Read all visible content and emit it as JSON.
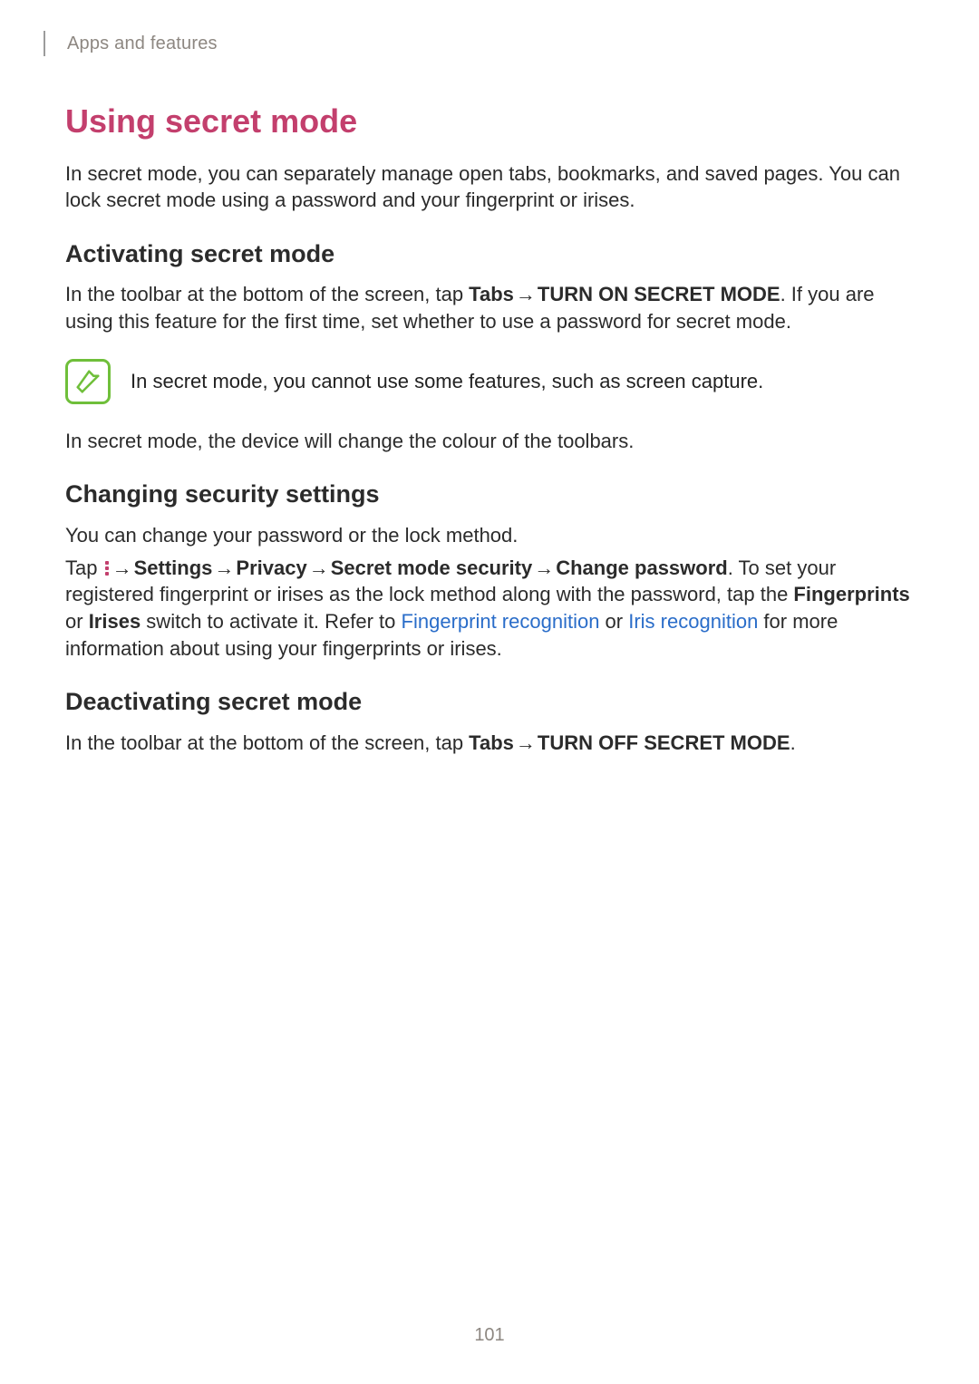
{
  "header": {
    "breadcrumb": "Apps and features"
  },
  "title": "Using secret mode",
  "intro": "In secret mode, you can separately manage open tabs, bookmarks, and saved pages. You can lock secret mode using a password and your fingerprint or irises.",
  "activating": {
    "heading": "Activating secret mode",
    "p1_a": "In the toolbar at the bottom of the screen, tap ",
    "tabs_label": "Tabs",
    "arrow": " → ",
    "turn_on": "TURN ON SECRET MODE",
    "p1_b": ". If you are using this feature for the first time, set whether to use a password for secret mode.",
    "note": "In secret mode, you cannot use some features, such as screen capture.",
    "p2": "In secret mode, the device will change the colour of the toolbars."
  },
  "changing": {
    "heading": "Changing security settings",
    "p1": "You can change your password or the lock method.",
    "path": {
      "tap": "Tap ",
      "settings": "Settings",
      "privacy": "Privacy",
      "sms": "Secret mode security",
      "change_pw": "Change password"
    },
    "p2_a": ". To set your registered fingerprint or irises as the lock method along with the password, tap the ",
    "fp": "Fingerprints",
    "or1": " or ",
    "irises": "Irises",
    "p2_b": " switch to activate it. Refer to ",
    "link_fp": "Fingerprint recognition",
    "or2": " or ",
    "link_iris": "Iris recognition",
    "p2_c": " for more information about using your fingerprints or irises."
  },
  "deactivating": {
    "heading": "Deactivating secret mode",
    "p1_a": "In the toolbar at the bottom of the screen, tap ",
    "tabs_label": "Tabs",
    "arrow": " → ",
    "turn_off": "TURN OFF SECRET MODE",
    "p1_b": "."
  },
  "page_number": "101"
}
